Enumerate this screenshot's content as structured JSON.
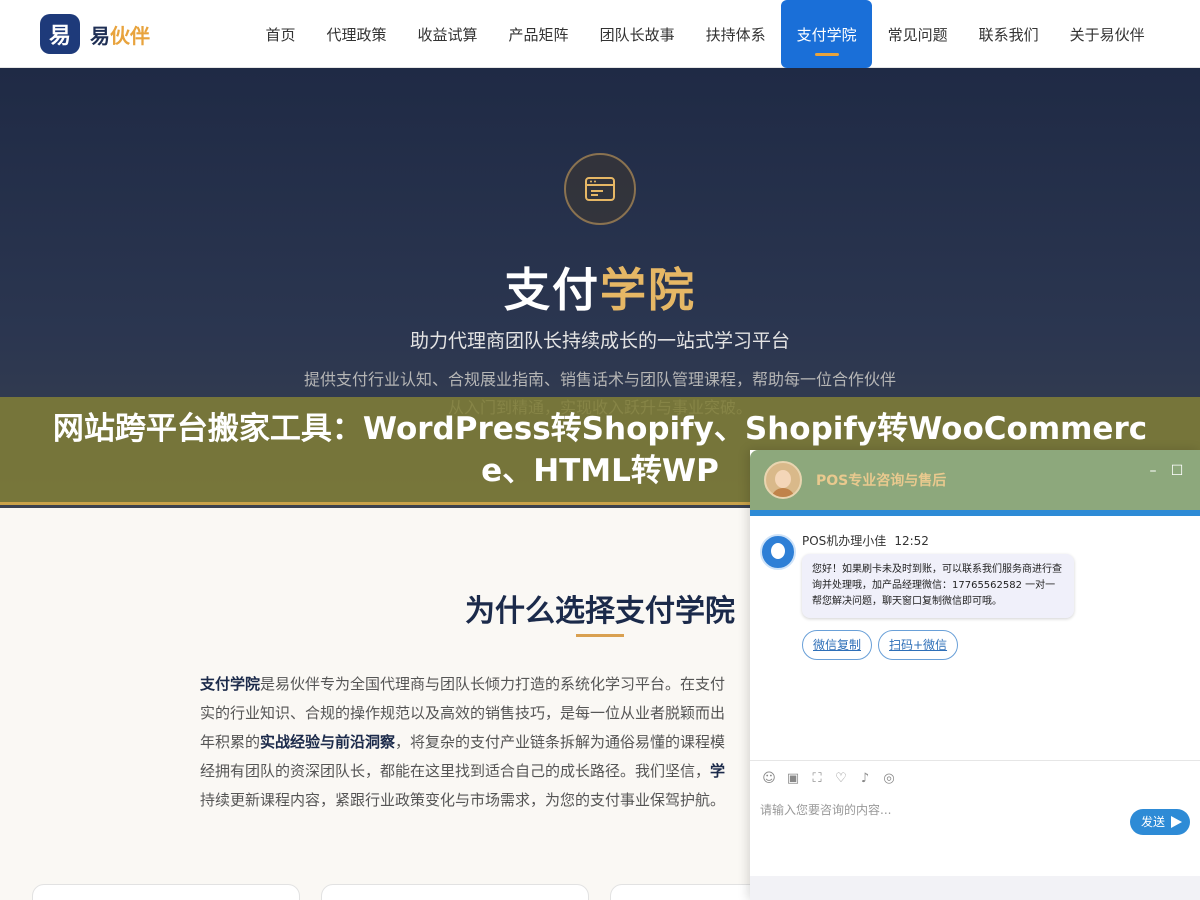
{
  "nav": {
    "logo_mark": "易",
    "logo_text": "易",
    "logo_highlight": "伙伴",
    "items": [
      {
        "label": "首页"
      },
      {
        "label": "代理政策"
      },
      {
        "label": "收益试算"
      },
      {
        "label": "产品矩阵"
      },
      {
        "label": "团队长故事"
      },
      {
        "label": "扶持体系"
      },
      {
        "label": "支付学院",
        "active": true
      },
      {
        "label": "常见问题"
      },
      {
        "label": "联系我们"
      },
      {
        "label": "关于易伙伴"
      }
    ],
    "active_color": "#1a6fd8"
  },
  "hero": {
    "icon": "card-icon",
    "title_main": "支付",
    "title_highlight": "学院",
    "subtitle": "助力代理商团队长持续成长的一站式学习平台",
    "description": "提供支付行业认知、合规展业指南、销售话术与团队管理课程，帮助每一位合作伙伴从入门到精通，实现收入跃升与事业突破。"
  },
  "overlay": {
    "text": "网站跨平台搬家工具：WordPress转Shopify、Shopify转WooCommerce、HTML转WP"
  },
  "why": {
    "title": "为什么选择支付学院",
    "p_bold1": "支付学院",
    "p_text1": "是易伙伴专为全国代理商与团队长倾力打造的系统化学习平台。在支付",
    "p_text2": "实的行业知识、合规的操作规范以及高效的销售技巧，是每一位从业者脱颖而出",
    "p_text3": "年积累的",
    "p_bold2": "实战经验与前沿洞察",
    "p_text4": "，将复杂的支付产业链条拆解为通俗易懂的课程模",
    "p_text5": "经拥有团队的资深团队长，都能在这里找到适合自己的成长路径。我们坚信，",
    "p_bold3": "学",
    "p_text6": "持续更新课程内容，紧跟行业政策变化与市场需求，为您的支付事业保驾护航。"
  },
  "chat": {
    "title": "POS专业咨询与售后",
    "minimize_icon": "minimize-icon",
    "maximize_icon": "maximize-icon",
    "agent_name": "POS机办理小佳",
    "time": "12:52",
    "message": "您好！如果刷卡未及时到账，可以联系我们服务商进行查询并处理哦，加产品经理微信：17765562582 一对一帮您解决问题，聊天窗口复制微信即可哦。",
    "quick_replies": [
      "微信复制",
      "扫码+微信"
    ],
    "tools": [
      "emoji-icon",
      "image-icon",
      "screenshot-icon",
      "rating-icon",
      "voice-icon",
      "wechat-icon"
    ],
    "input_placeholder": "请输入您要咨询的内容...",
    "send_label": "发送",
    "header_color": "#8da87c",
    "accent": "#2e8bd6"
  }
}
